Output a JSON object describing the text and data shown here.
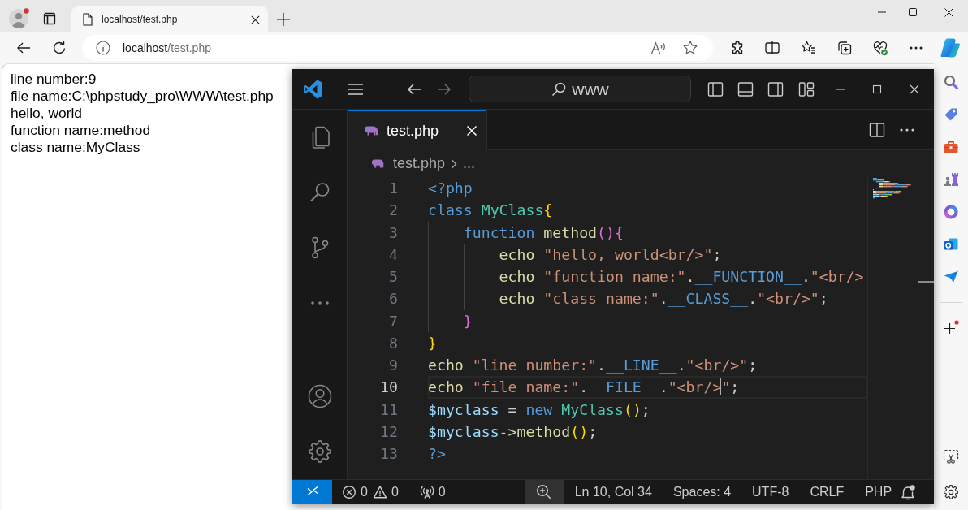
{
  "browser": {
    "profile": {
      "notification": true
    },
    "tab": {
      "title": "localhost/test.php",
      "selected": true
    },
    "address": {
      "host": "localhost",
      "path": "/test.php"
    },
    "sidebar": {
      "add_notification": true
    }
  },
  "page": {
    "lines": [
      "line number:9",
      "file name:C:\\phpstudy_pro\\WWW\\test.php",
      "hello, world",
      "function name:method",
      "class name:MyClass"
    ]
  },
  "vscode": {
    "navigation": [
      {
        "kind": "back",
        "disabled": false
      },
      {
        "kind": "forward",
        "disabled": true
      }
    ],
    "command_center": {
      "text": "www"
    },
    "tabs": [
      {
        "label": "test.php",
        "selected": true
      }
    ],
    "breadcrumbs": [
      {
        "kind": "file",
        "label": "test.php"
      },
      {
        "kind": "symbols",
        "label": "..."
      }
    ],
    "editor": {
      "lines": [
        {
          "number": "1",
          "current": false,
          "tokens": [
            {
              "kind": "keyword",
              "text": "<?php"
            }
          ]
        },
        {
          "number": "2",
          "current": false,
          "tokens": [
            {
              "kind": "keyword",
              "text": "class "
            },
            {
              "kind": "type",
              "text": "MyClass"
            },
            {
              "kind": "bracket1",
              "text": "{"
            }
          ],
          "children": [
            {
              "number": "3",
              "current": false,
              "tokens": [
                {
                  "kind": "keyword",
                  "text": "function "
                },
                {
                  "kind": "function",
                  "text": "method"
                },
                {
                  "kind": "bracket2",
                  "text": "(){"
                }
              ],
              "children": [
                {
                  "number": "4",
                  "current": false,
                  "tokens": [
                    {
                      "kind": "function",
                      "text": "echo "
                    },
                    {
                      "kind": "string",
                      "text": "\"hello, world<br/>\""
                    },
                    {
                      "kind": "plain",
                      "text": ";"
                    }
                  ]
                },
                {
                  "number": "5",
                  "current": false,
                  "tokens": [
                    {
                      "kind": "function",
                      "text": "echo "
                    },
                    {
                      "kind": "string",
                      "text": "\"function name:\""
                    },
                    {
                      "kind": "plain",
                      "text": "."
                    },
                    {
                      "kind": "constant",
                      "text": "__FUNCTION__"
                    },
                    {
                      "kind": "plain",
                      "text": "."
                    },
                    {
                      "kind": "string",
                      "text": "\"<br/>"
                    }
                  ]
                },
                {
                  "number": "6",
                  "current": false,
                  "tokens": [
                    {
                      "kind": "function",
                      "text": "echo "
                    },
                    {
                      "kind": "string",
                      "text": "\"class name:\""
                    },
                    {
                      "kind": "plain",
                      "text": "."
                    },
                    {
                      "kind": "constant",
                      "text": "__CLASS__"
                    },
                    {
                      "kind": "plain",
                      "text": "."
                    },
                    {
                      "kind": "string",
                      "text": "\"<br/>\""
                    },
                    {
                      "kind": "plain",
                      "text": ";"
                    }
                  ]
                }
              ]
            },
            {
              "number": "7",
              "current": false,
              "tokens": [
                {
                  "kind": "bracket2",
                  "text": "}"
                }
              ]
            }
          ]
        },
        {
          "number": "8",
          "current": false,
          "tokens": [
            {
              "kind": "bracket1",
              "text": "}"
            }
          ]
        },
        {
          "number": "9",
          "current": false,
          "tokens": [
            {
              "kind": "function",
              "text": "echo "
            },
            {
              "kind": "string",
              "text": "\"line number:\""
            },
            {
              "kind": "plain",
              "text": "."
            },
            {
              "kind": "constant",
              "text": "__LINE__"
            },
            {
              "kind": "plain",
              "text": "."
            },
            {
              "kind": "string",
              "text": "\"<br/>\""
            },
            {
              "kind": "plain",
              "text": ";"
            }
          ]
        },
        {
          "number": "10",
          "current": true,
          "tokens": [
            {
              "kind": "function",
              "text": "echo "
            },
            {
              "kind": "string",
              "text": "\"file name:\""
            },
            {
              "kind": "plain",
              "text": "."
            },
            {
              "kind": "constant",
              "text": "__FILE__"
            },
            {
              "kind": "plain",
              "text": "."
            },
            {
              "kind": "string",
              "text": "\"<br/>"
            },
            {
              "kind": "caret"
            },
            {
              "kind": "string",
              "text": "\""
            },
            {
              "kind": "plain",
              "text": ";"
            }
          ]
        },
        {
          "number": "11",
          "current": false,
          "tokens": [
            {
              "kind": "variable",
              "text": "$myclass"
            },
            {
              "kind": "plain",
              "text": " = "
            },
            {
              "kind": "keyword",
              "text": "new "
            },
            {
              "kind": "type",
              "text": "MyClass"
            },
            {
              "kind": "bracket1",
              "text": "()"
            },
            {
              "kind": "plain",
              "text": ";"
            }
          ]
        },
        {
          "number": "12",
          "current": false,
          "tokens": [
            {
              "kind": "variable",
              "text": "$myclass"
            },
            {
              "kind": "plain",
              "text": "->"
            },
            {
              "kind": "function",
              "text": "method"
            },
            {
              "kind": "bracket1",
              "text": "()"
            },
            {
              "kind": "plain",
              "text": ";"
            }
          ]
        },
        {
          "number": "13",
          "current": false,
          "tokens": [
            {
              "kind": "keyword",
              "text": "?>"
            }
          ]
        }
      ]
    },
    "status_bar": {
      "errors": "0",
      "warnings": "0",
      "ports": "0",
      "position": "Ln 10, Col 34",
      "indentation": "Spaces: 4",
      "encoding": "UTF-8",
      "eol": "CRLF",
      "language": "PHP",
      "bell_dot": true
    }
  }
}
